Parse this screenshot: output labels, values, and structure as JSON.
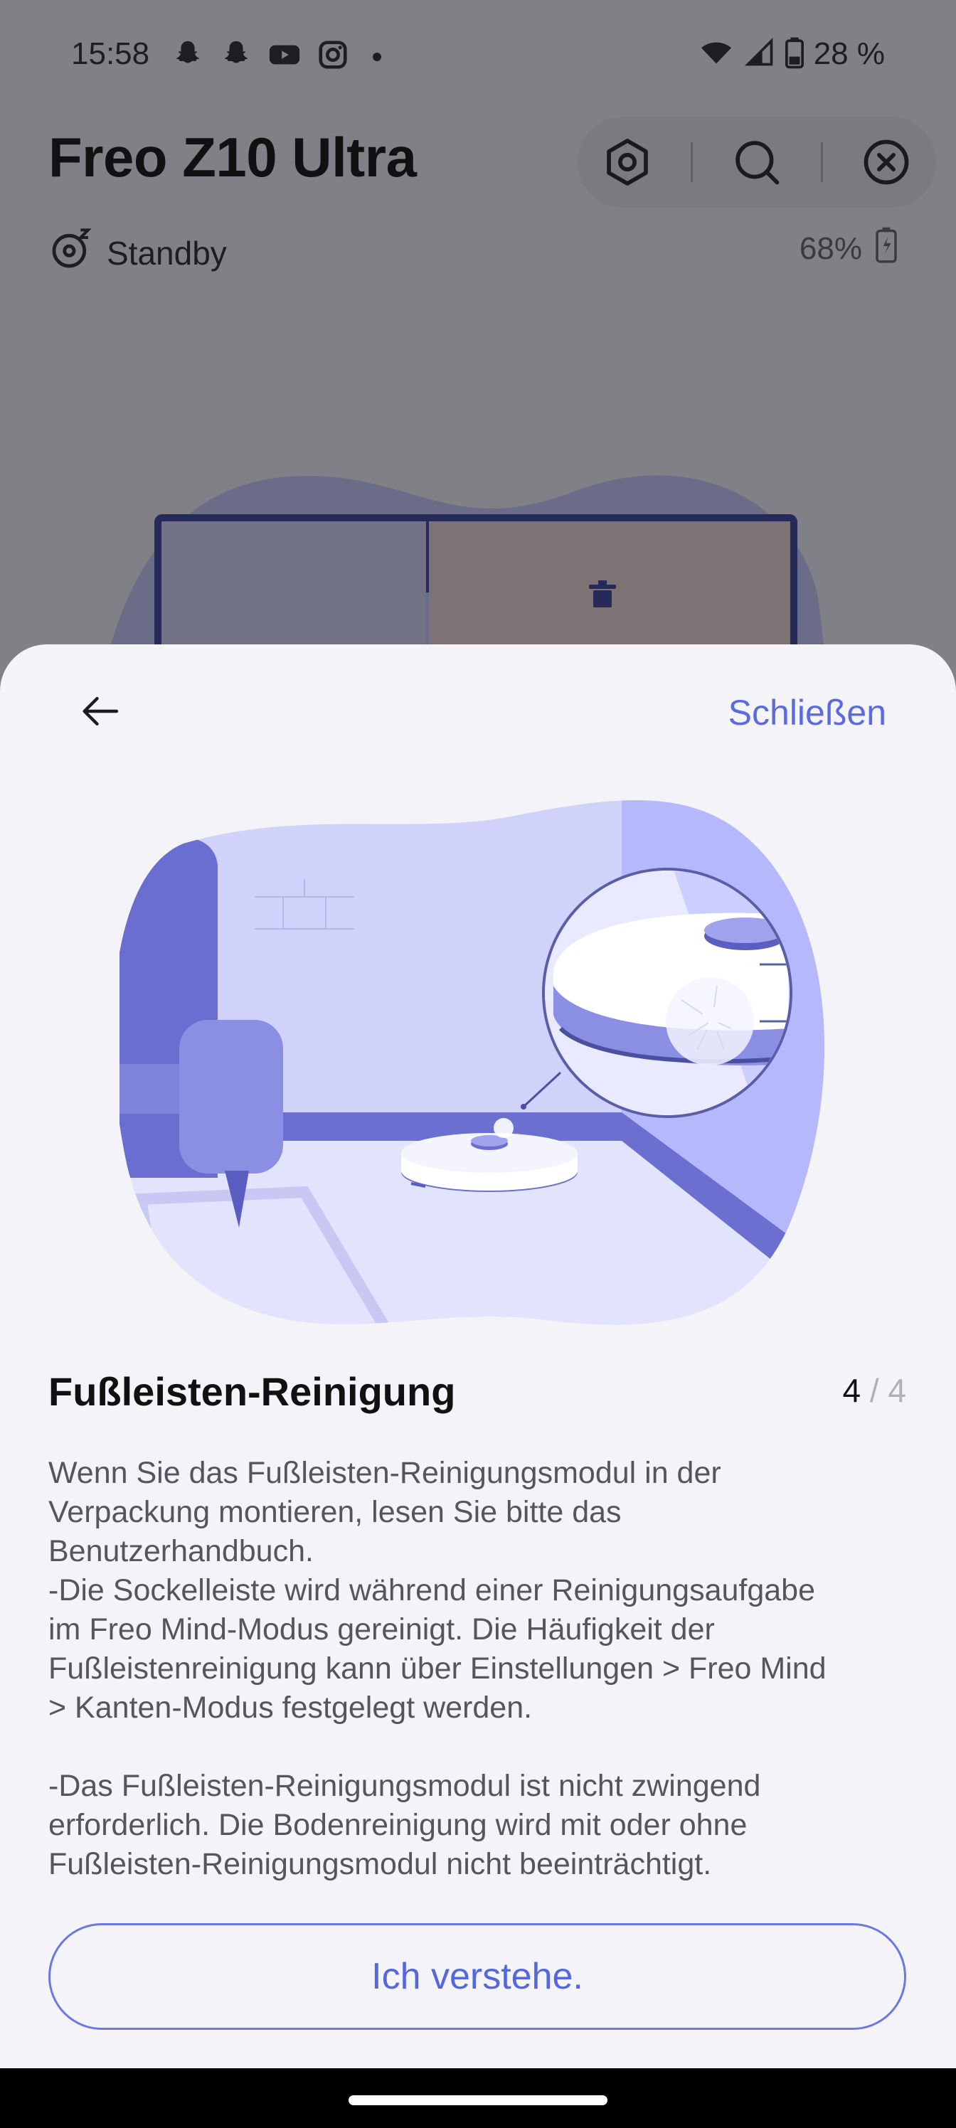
{
  "status_bar": {
    "time": "15:58",
    "left_icons": [
      "snapchat-icon",
      "snapchat-icon",
      "youtube-icon",
      "instagram-icon",
      "dot-icon"
    ],
    "right_icons": [
      "wifi-icon",
      "signal-icon",
      "battery-icon"
    ],
    "battery": "28 %"
  },
  "app": {
    "title": "Freo Z10 Ultra",
    "state": "Standby",
    "battery_level": "68%",
    "toolbar_icons": [
      "settings-hex-icon",
      "search-icon",
      "close-circle-icon"
    ]
  },
  "sheet": {
    "close_label": "Schließen",
    "title": "Fußleisten-Reinigung",
    "page_current": "4",
    "page_separator": " / ",
    "page_total": "4",
    "description": "Wenn Sie das Fußleisten-Reinigungsmodul in der\nVerpackung montieren, lesen Sie bitte das\nBenutzerhandbuch.\n-Die Sockelleiste wird während einer Reinigungsaufgabe\nim Freo Mind-Modus gereinigt. Die Häufigkeit der\nFußleistenreinigung kann über Einstellungen > Freo Mind\n> Kanten-Modus festgelegt werden.\n\n-Das Fußleisten-Reinigungsmodul ist nicht zwingend\nerforderlich. Die Bodenreinigung wird mit oder ohne\nFußleisten-Reinigungsmodul nicht beeinträchtigt.",
    "confirm_label": "Ich verstehe."
  },
  "colors": {
    "accent": "#5a6be0",
    "sheet_bg": "#f4f4f8",
    "scrim": "#808086",
    "illustration_purple": "#6a6fd0"
  }
}
